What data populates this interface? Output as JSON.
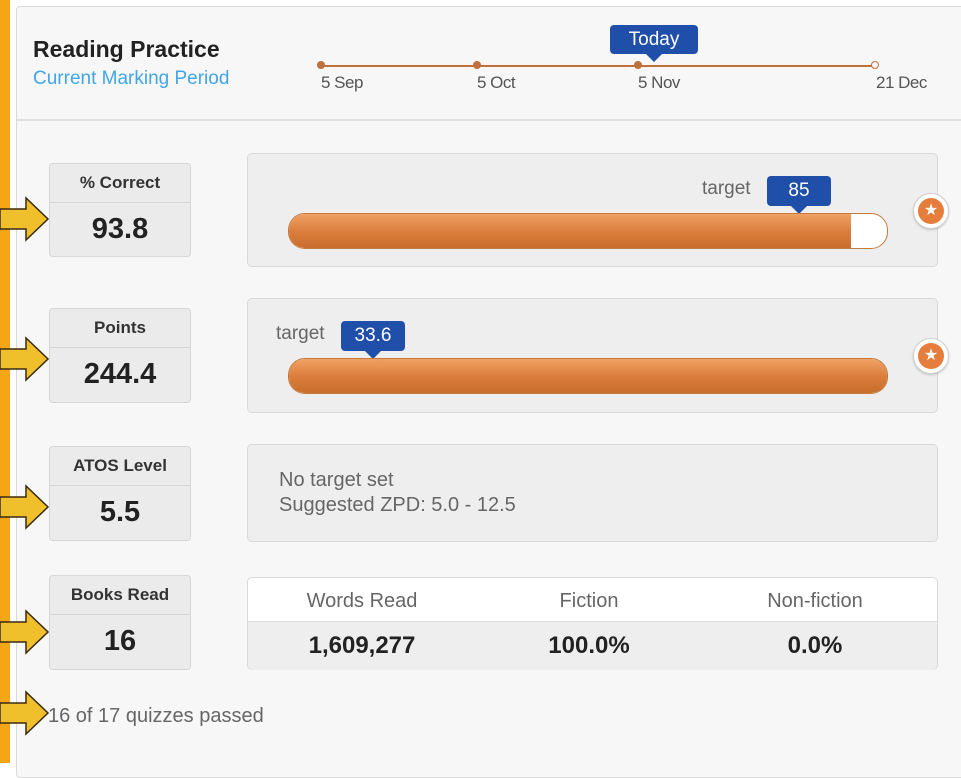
{
  "header": {
    "title": "Reading Practice",
    "subtitle": "Current Marking Period",
    "timeline": {
      "today_label": "Today",
      "dates": [
        "5 Sep",
        "5 Oct",
        "5 Nov",
        "21 Dec"
      ]
    }
  },
  "stats": {
    "correct": {
      "label": "% Correct",
      "value": "93.8",
      "target_label": "target",
      "target_value": "85",
      "progress_pct": 94
    },
    "points": {
      "label": "Points",
      "value": "244.4",
      "target_label": "target",
      "target_value": "33.6",
      "progress_pct": 100
    },
    "atos": {
      "label": "ATOS Level",
      "value": "5.5",
      "note_line1": "No target set",
      "note_line2": "Suggested ZPD: 5.0 - 12.5"
    },
    "books": {
      "label": "Books Read",
      "value": "16",
      "columns": [
        {
          "header": "Words Read",
          "value": "1,609,277"
        },
        {
          "header": "Fiction",
          "value": "100.0%"
        },
        {
          "header": "Non-fiction",
          "value": "0.0%"
        }
      ]
    }
  },
  "footer": {
    "quizzes_text": "16 of 17 quizzes passed"
  },
  "colors": {
    "accent_orange": "#e57d3c",
    "badge_blue": "#1f4fa8",
    "link_blue": "#42a5e6",
    "arrow_yellow": "#f0c02c",
    "sidebar_orange": "#f5a516"
  },
  "icons": {
    "star": "star-icon",
    "arrow": "right-arrow-icon"
  }
}
